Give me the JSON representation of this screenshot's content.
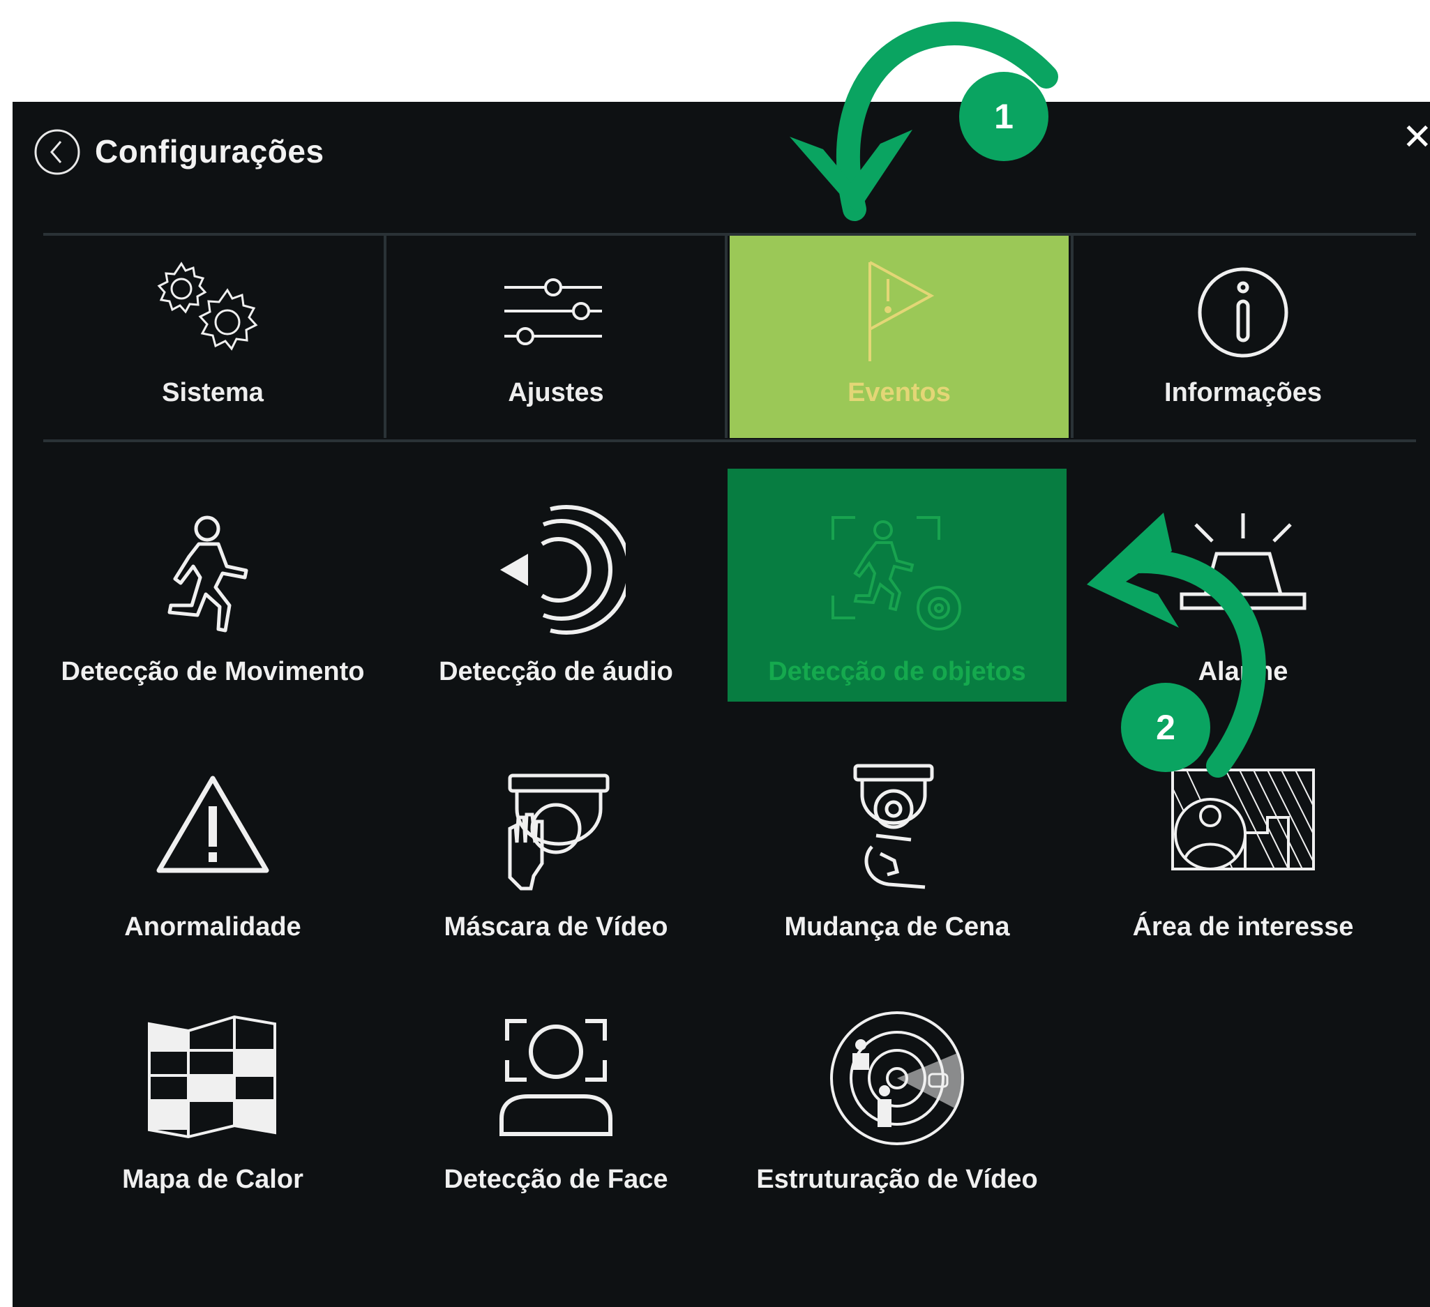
{
  "header": {
    "title": "Configurações",
    "back_icon": "chevron-left-icon",
    "close_symbol": "✕"
  },
  "tabs": [
    {
      "label": "Sistema",
      "icon": "gears-icon"
    },
    {
      "label": "Ajustes",
      "icon": "sliders-icon"
    },
    {
      "label": "Eventos",
      "icon": "flag-alert-icon",
      "active": true
    },
    {
      "label": "Informações",
      "icon": "info-icon"
    }
  ],
  "items": [
    {
      "label": "Detecção de Movimento",
      "icon": "running-person-icon"
    },
    {
      "label": "Detecção de áudio",
      "icon": "speaker-waves-icon"
    },
    {
      "label": "Detecção de objetos",
      "icon": "object-detection-icon",
      "selected": true
    },
    {
      "label": "Alarme",
      "icon": "siren-icon"
    },
    {
      "label": "Anormalidade",
      "icon": "warning-icon"
    },
    {
      "label": "Máscara de Vídeo",
      "icon": "camera-mask-icon"
    },
    {
      "label": "Mudança de Cena",
      "icon": "camera-rotate-icon"
    },
    {
      "label": "Área de interesse",
      "icon": "region-of-interest-icon"
    },
    {
      "label": "Mapa de Calor",
      "icon": "heatmap-icon"
    },
    {
      "label": "Detecção de Face",
      "icon": "face-detection-icon"
    },
    {
      "label": "Estruturação de Vídeo",
      "icon": "video-structuring-icon"
    }
  ],
  "annotations": [
    {
      "number": "1"
    },
    {
      "number": "2"
    }
  ],
  "colors": {
    "panel_bg": "#0e1113",
    "active_tab_bg": "#9bc857",
    "active_tab_text": "#e3d676",
    "selected_item_bg": "#077d41",
    "selected_item_text": "#15a94e",
    "annotation_green": "#0aa461"
  }
}
